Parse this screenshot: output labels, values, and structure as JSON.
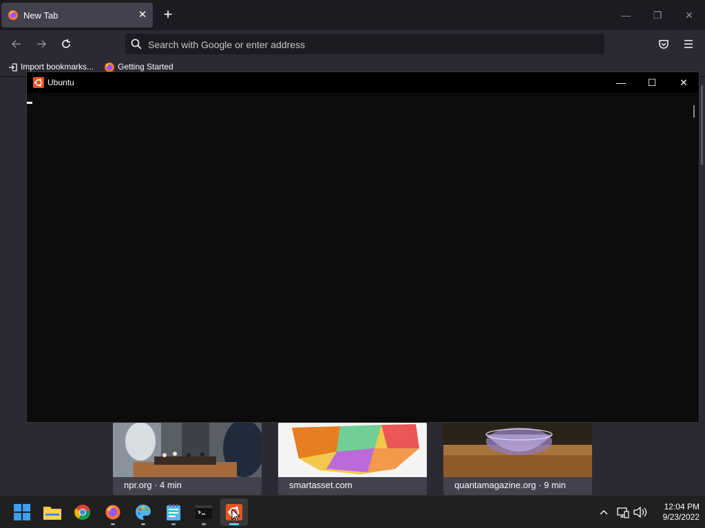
{
  "browser": {
    "tab": {
      "title": "New Tab",
      "close_glyph": "✕"
    },
    "new_tab_glyph": "+",
    "window_controls": {
      "minimize": "—",
      "restore": "❐",
      "close": "✕"
    },
    "nav": {
      "back_icon": "arrow-left-icon",
      "forward_icon": "arrow-right-icon",
      "reload_icon": "reload-icon"
    },
    "urlbar": {
      "placeholder": "Search with Google or enter address"
    },
    "toolbar": {
      "pocket_icon": "pocket-icon",
      "menu_icon": "hamburger-menu-icon"
    },
    "bookmarks": [
      {
        "label": "Import bookmarks...",
        "icon": "import-icon"
      },
      {
        "label": "Getting Started",
        "icon": "firefox-icon"
      }
    ],
    "stories": [
      {
        "source": "npr.org · 4 min",
        "thumb": "chess-photo"
      },
      {
        "source": "smartasset.com",
        "thumb": "us-map"
      },
      {
        "source": "quantamagazine.org · 9 min",
        "thumb": "glass-teacup"
      }
    ]
  },
  "terminal": {
    "title": "Ubuntu",
    "icon": "ubuntu-icon",
    "controls": {
      "minimize": "—",
      "maximize": "☐",
      "close": "✕"
    }
  },
  "taskbar": {
    "apps": [
      {
        "name": "start",
        "icon": "windows-start-icon"
      },
      {
        "name": "file-explorer",
        "icon": "folder-icon"
      },
      {
        "name": "chrome",
        "icon": "chrome-icon"
      },
      {
        "name": "firefox",
        "icon": "firefox-icon"
      },
      {
        "name": "paint",
        "icon": "paint-icon"
      },
      {
        "name": "notepad",
        "icon": "notepad-icon"
      },
      {
        "name": "terminal",
        "icon": "terminal-icon"
      },
      {
        "name": "ubuntu",
        "icon": "ubuntu-icon"
      }
    ],
    "tray": {
      "chevron": "^",
      "network_icon": "network-icon",
      "volume_icon": "volume-icon"
    },
    "clock": {
      "time": "12:04 PM",
      "date": "9/23/2022"
    }
  },
  "colors": {
    "ubuntu_orange": "#e95420",
    "accent": "#60cdff"
  }
}
